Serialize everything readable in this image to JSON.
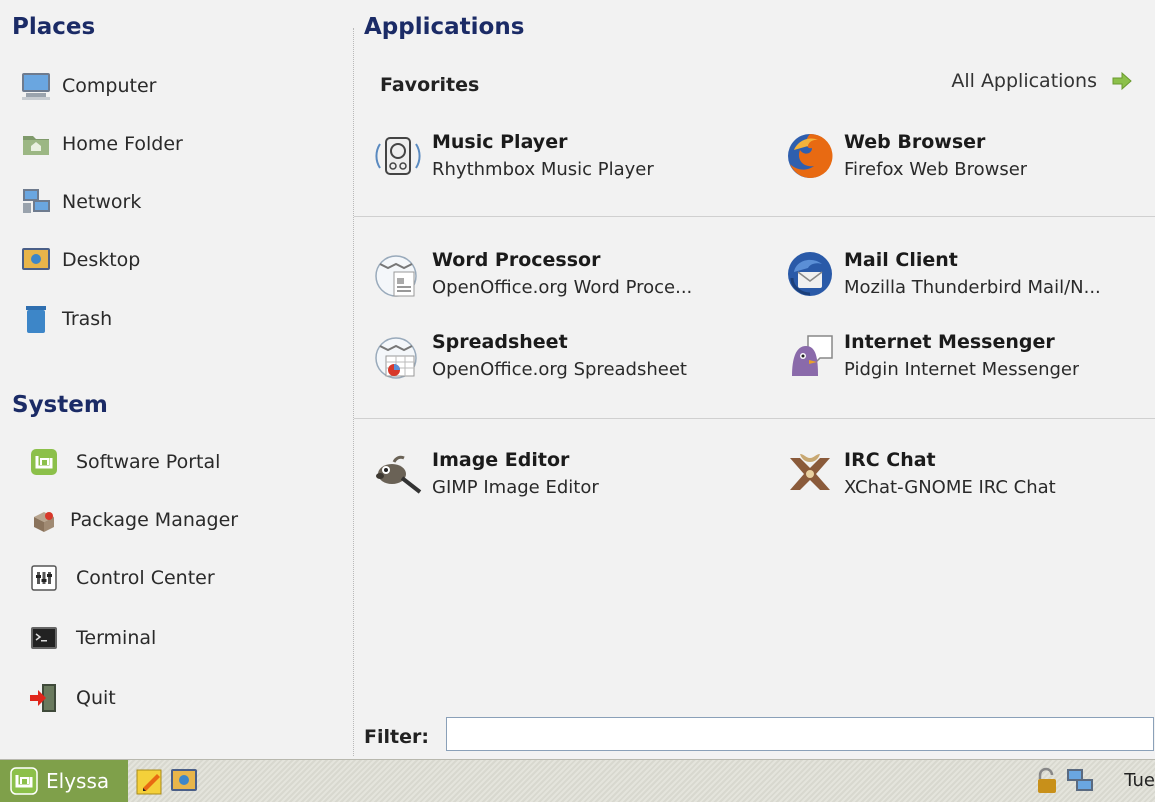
{
  "places": {
    "title": "Places",
    "items": [
      {
        "label": "Computer",
        "icon": "computer-icon"
      },
      {
        "label": "Home Folder",
        "icon": "home-folder-icon"
      },
      {
        "label": "Network",
        "icon": "network-icon"
      },
      {
        "label": "Desktop",
        "icon": "desktop-icon"
      },
      {
        "label": "Trash",
        "icon": "trash-icon"
      }
    ]
  },
  "system": {
    "title": "System",
    "items": [
      {
        "label": "Software Portal",
        "icon": "mint-logo-icon"
      },
      {
        "label": "Package Manager",
        "icon": "package-manager-icon"
      },
      {
        "label": "Control Center",
        "icon": "control-center-icon"
      },
      {
        "label": "Terminal",
        "icon": "terminal-icon"
      },
      {
        "label": "Quit",
        "icon": "quit-icon"
      }
    ]
  },
  "applications": {
    "title": "Applications",
    "favorites_label": "Favorites",
    "all_apps_label": "All Applications",
    "apps": [
      {
        "name": "Music Player",
        "desc": "Rhythmbox Music Player",
        "icon": "rhythmbox-icon"
      },
      {
        "name": "Web Browser",
        "desc": "Firefox Web Browser",
        "icon": "firefox-icon"
      },
      {
        "name": "Word Processor",
        "desc": "OpenOffice.org Word Proce...",
        "icon": "word-processor-icon"
      },
      {
        "name": "Mail Client",
        "desc": "Mozilla Thunderbird Mail/N...",
        "icon": "thunderbird-icon"
      },
      {
        "name": "Spreadsheet",
        "desc": "OpenOffice.org Spreadsheet",
        "icon": "spreadsheet-icon"
      },
      {
        "name": "Internet Messenger",
        "desc": "Pidgin Internet Messenger",
        "icon": "pidgin-icon"
      },
      {
        "name": "Image Editor",
        "desc": "GIMP Image Editor",
        "icon": "gimp-icon"
      },
      {
        "name": "IRC Chat",
        "desc": "XChat-GNOME IRC Chat",
        "icon": "xchat-icon"
      }
    ]
  },
  "filter": {
    "label": "Filter:",
    "value": ""
  },
  "taskbar": {
    "start_label": "Elyssa",
    "clock": "Tue"
  },
  "colors": {
    "title": "#1b2b66",
    "mint_green": "#7fa04a"
  }
}
